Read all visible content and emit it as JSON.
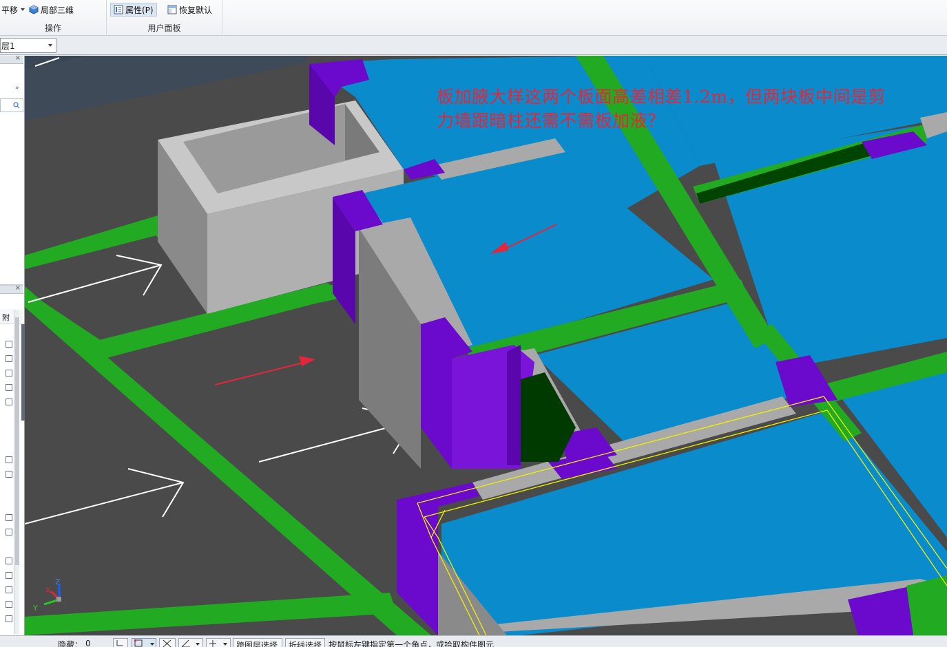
{
  "ribbon": {
    "operate_group": {
      "caption": "操作",
      "pan_label": "平移",
      "local3d_label": "局部三维"
    },
    "user_panel_group": {
      "caption": "用户面板",
      "properties_label": "属性(P)",
      "restore_default_label": "恢复默认"
    }
  },
  "toolbar2": {
    "floor_selector_value": "层1"
  },
  "left_panel": {
    "column_header_label": "附"
  },
  "viewport": {
    "annotation_line1": "板加腋大样这两个板面高差相差1.2m，但两块板中间是剪",
    "annotation_line2": "力墙跟暗柱还需不需板加液？",
    "axis_labels": {
      "x": "X",
      "y": "Y",
      "z": "Z"
    }
  },
  "status_bar": {
    "hidden_label": "隐藏：",
    "hidden_count": "0",
    "cross_floor_select": "跨图层选择",
    "polyline_select": "折线选择",
    "prompt": "按鼠标左键指定第一个角点，或拾取构件图元"
  },
  "colors": {
    "slab_blue": "#0a8ccc",
    "beam_green": "#22aa22",
    "column_purple": "#6b09cc",
    "wall_gray": "#a9a9a9",
    "ground_dark": "#4a4a4a",
    "annotation_red": "#e4253a",
    "highlight_yellow": "#f0f000"
  }
}
